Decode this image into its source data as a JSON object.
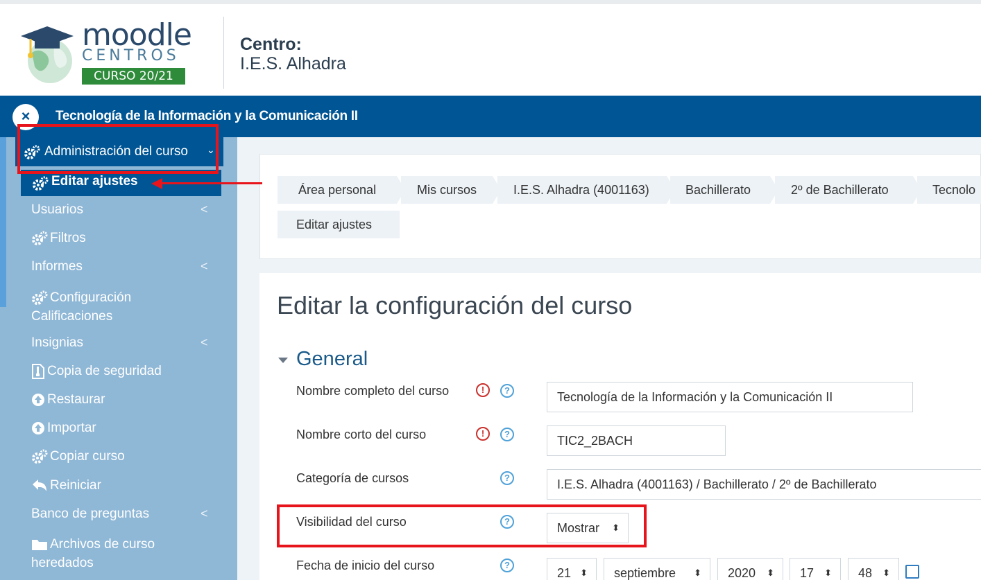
{
  "header": {
    "logo": {
      "word": "moodle",
      "sub": "CENTROS",
      "badge": "CURSO 20/21"
    },
    "centro_label": "Centro:",
    "centro_name": "I.E.S. Alhadra"
  },
  "course_bar": {
    "close_symbol": "×",
    "title": "Tecnología de la Información y la Comunicación II"
  },
  "sidebar": {
    "admin": {
      "label": "Administración del curso",
      "icon": "gears-icon"
    },
    "edit": {
      "label": "Editar ajustes",
      "icon": "gears-icon"
    },
    "items": [
      {
        "label": "Usuarios",
        "icon": "",
        "chevron": "<"
      },
      {
        "label": "Filtros",
        "icon": "gears-icon",
        "chevron": ""
      },
      {
        "label": "Informes",
        "icon": "",
        "chevron": "<"
      },
      {
        "label": "Configuración",
        "label2": "Calificaciones",
        "icon": "gears-icon",
        "chevron": ""
      },
      {
        "label": "Insignias",
        "icon": "",
        "chevron": "<"
      },
      {
        "label": "Copia de seguridad",
        "icon": "file-archive-icon",
        "chevron": ""
      },
      {
        "label": "Restaurar",
        "icon": "upload-circle-icon",
        "chevron": ""
      },
      {
        "label": "Importar",
        "icon": "upload-circle-icon",
        "chevron": ""
      },
      {
        "label": "Copiar curso",
        "icon": "gears-icon",
        "chevron": ""
      },
      {
        "label": "Reiniciar",
        "icon": "undo-icon",
        "chevron": ""
      },
      {
        "label": "Banco de preguntas",
        "icon": "",
        "chevron": "<"
      },
      {
        "label": "Archivos de curso",
        "label2": "heredados",
        "icon": "folder-icon",
        "chevron": ""
      }
    ]
  },
  "breadcrumb": {
    "items": [
      "Área personal",
      "Mis cursos",
      "I.E.S. Alhadra (4001163)",
      "Bachillerato",
      "2º de Bachillerato",
      "Tecnolo"
    ],
    "current": "Editar ajustes"
  },
  "main": {
    "title": "Editar la configuración del curso",
    "section": "General",
    "fields": {
      "fullname": {
        "label": "Nombre completo del curso",
        "value": "Tecnología de la Información y la Comunicación II"
      },
      "shortname": {
        "label": "Nombre corto del curso",
        "value": "TIC2_2BACH"
      },
      "category": {
        "label": "Categoría de cursos",
        "value": "I.E.S. Alhadra (4001163) / Bachillerato / 2º de Bachillerato"
      },
      "visibility": {
        "label": "Visibilidad del curso",
        "value": "Mostrar"
      },
      "startdate": {
        "label": "Fecha de inicio del curso",
        "day": "21",
        "month": "septiembre",
        "year": "2020",
        "hour": "17",
        "minute": "48"
      }
    },
    "required_symbol": "!",
    "help_symbol": "?",
    "sort_symbol": "⬍"
  },
  "colors": {
    "brand": "#005594",
    "sidebar": "#8fb7d6",
    "highlight": "#e8141b"
  }
}
